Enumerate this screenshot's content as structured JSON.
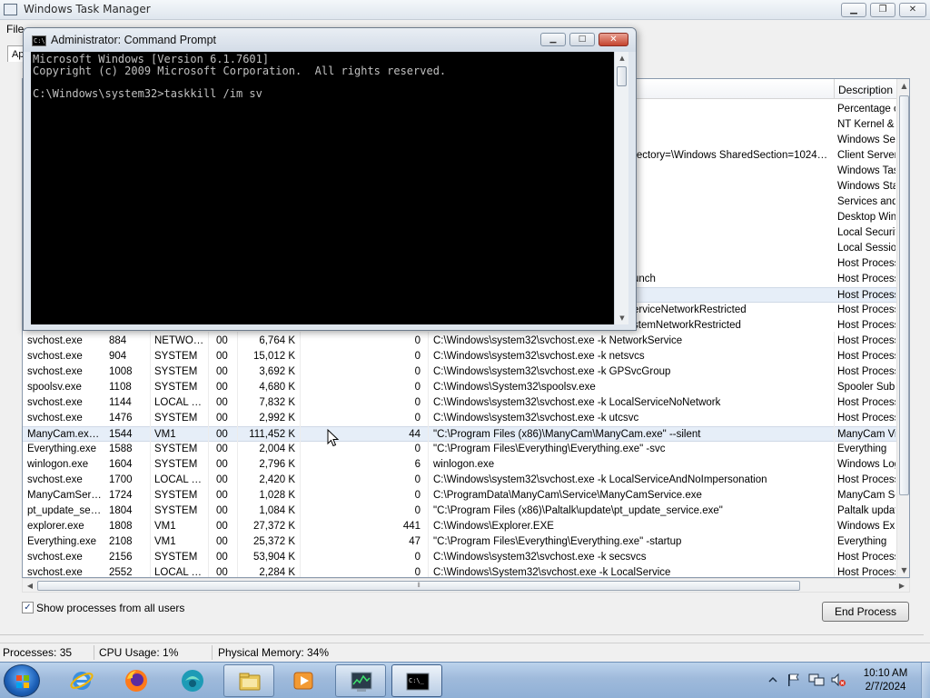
{
  "task_manager": {
    "title": "Windows Task Manager",
    "menu_first": "File",
    "tab_stub": "Ap",
    "column_description": "Description",
    "upper_desc_column": [
      "Percentage o",
      "NT Kernel & S",
      "Windows Ses",
      "Client Server",
      "Windows Tas",
      "Windows Sta",
      "Services and",
      "Desktop Win",
      "Local Securit",
      "Local Session",
      "Host Process",
      "Host Process",
      "Host Process",
      "Host Process",
      "Host Process"
    ],
    "upper_cmd_fragments": {
      "row4": "rectory=\\Windows SharedSection=1024…",
      "row12": "unch",
      "row14": "erviceNetworkRestricted",
      "row15": "stemNetworkRestricted"
    },
    "rows": [
      {
        "name": "svchost.exe",
        "pid": "884",
        "user": "NETWO…",
        "cpu": "00",
        "mem": "6,764 K",
        "c6": "0",
        "cmd": "C:\\Windows\\system32\\svchost.exe -k NetworkService",
        "desc": "Host Process"
      },
      {
        "name": "svchost.exe",
        "pid": "904",
        "user": "SYSTEM",
        "cpu": "00",
        "mem": "15,012 K",
        "c6": "0",
        "cmd": "C:\\Windows\\system32\\svchost.exe -k netsvcs",
        "desc": "Host Process"
      },
      {
        "name": "svchost.exe",
        "pid": "1008",
        "user": "SYSTEM",
        "cpu": "00",
        "mem": "3,692 K",
        "c6": "0",
        "cmd": "C:\\Windows\\system32\\svchost.exe -k GPSvcGroup",
        "desc": "Host Process"
      },
      {
        "name": "spoolsv.exe",
        "pid": "1108",
        "user": "SYSTEM",
        "cpu": "00",
        "mem": "4,680 K",
        "c6": "0",
        "cmd": "C:\\Windows\\System32\\spoolsv.exe",
        "desc": "Spooler SubS"
      },
      {
        "name": "svchost.exe",
        "pid": "1144",
        "user": "LOCAL …",
        "cpu": "00",
        "mem": "7,832 K",
        "c6": "0",
        "cmd": "C:\\Windows\\system32\\svchost.exe -k LocalServiceNoNetwork",
        "desc": "Host Process"
      },
      {
        "name": "svchost.exe",
        "pid": "1476",
        "user": "SYSTEM",
        "cpu": "00",
        "mem": "2,992 K",
        "c6": "0",
        "cmd": "C:\\Windows\\system32\\svchost.exe -k utcsvc",
        "desc": "Host Process"
      },
      {
        "name": "ManyCam.ex…",
        "pid": "1544",
        "user": "VM1",
        "cpu": "00",
        "mem": "111,452 K",
        "c6": "44",
        "cmd": "\"C:\\Program Files (x86)\\ManyCam\\ManyCam.exe\" --silent",
        "desc": "ManyCam Vir"
      },
      {
        "name": "Everything.exe",
        "pid": "1588",
        "user": "SYSTEM",
        "cpu": "00",
        "mem": "2,004 K",
        "c6": "0",
        "cmd": "\"C:\\Program Files\\Everything\\Everything.exe\" -svc",
        "desc": "Everything"
      },
      {
        "name": "winlogon.exe",
        "pid": "1604",
        "user": "SYSTEM",
        "cpu": "00",
        "mem": "2,796 K",
        "c6": "6",
        "cmd": "winlogon.exe",
        "desc": "Windows Log"
      },
      {
        "name": "svchost.exe",
        "pid": "1700",
        "user": "LOCAL …",
        "cpu": "00",
        "mem": "2,420 K",
        "c6": "0",
        "cmd": "C:\\Windows\\system32\\svchost.exe -k LocalServiceAndNoImpersonation",
        "desc": "Host Process"
      },
      {
        "name": "ManyCamSer…",
        "pid": "1724",
        "user": "SYSTEM",
        "cpu": "00",
        "mem": "1,028 K",
        "c6": "0",
        "cmd": "C:\\ProgramData\\ManyCam\\Service\\ManyCamService.exe",
        "desc": "ManyCam Se"
      },
      {
        "name": "pt_update_se…",
        "pid": "1804",
        "user": "SYSTEM",
        "cpu": "00",
        "mem": "1,084 K",
        "c6": "0",
        "cmd": "\"C:\\Program Files (x86)\\Paltalk\\update\\pt_update_service.exe\"",
        "desc": "Paltalk updat"
      },
      {
        "name": "explorer.exe",
        "pid": "1808",
        "user": "VM1",
        "cpu": "00",
        "mem": "27,372 K",
        "c6": "441",
        "cmd": "C:\\Windows\\Explorer.EXE",
        "desc": "Windows Exp"
      },
      {
        "name": "Everything.exe",
        "pid": "2108",
        "user": "VM1",
        "cpu": "00",
        "mem": "25,372 K",
        "c6": "47",
        "cmd": "\"C:\\Program Files\\Everything\\Everything.exe\" -startup",
        "desc": "Everything"
      },
      {
        "name": "svchost.exe",
        "pid": "2156",
        "user": "SYSTEM",
        "cpu": "00",
        "mem": "53,904 K",
        "c6": "0",
        "cmd": "C:\\Windows\\system32\\svchost.exe -k secsvcs",
        "desc": "Host Process"
      },
      {
        "name": "svchost.exe",
        "pid": "2552",
        "user": "LOCAL …",
        "cpu": "00",
        "mem": "2,284 K",
        "c6": "0",
        "cmd": "C:\\Windows\\System32\\svchost.exe -k LocalService",
        "desc": "Host Process"
      }
    ],
    "selected_row_index": 6,
    "show_all_label": "Show processes from all users",
    "show_all_checked": "✓",
    "end_process_label": "End Process",
    "status": {
      "processes": "Processes: 35",
      "cpu": "CPU Usage: 1%",
      "memory": "Physical Memory: 34%"
    }
  },
  "cmd": {
    "title": "Administrator: Command Prompt",
    "console_lines": "Microsoft Windows [Version 6.1.7601]\nCopyright (c) 2009 Microsoft Corporation.  All rights reserved.\n\nC:\\Windows\\system32>taskkill /im sv"
  },
  "taskbar": {
    "pinned": [
      "start-orb",
      "internet-explorer-icon",
      "firefox-icon",
      "edge-like-globe-icon",
      "file-explorer-icon",
      "media-player-icon",
      "task-manager-icon",
      "command-prompt-icon"
    ],
    "clock_time": "10:10 AM",
    "clock_date": "2/7/2024"
  }
}
